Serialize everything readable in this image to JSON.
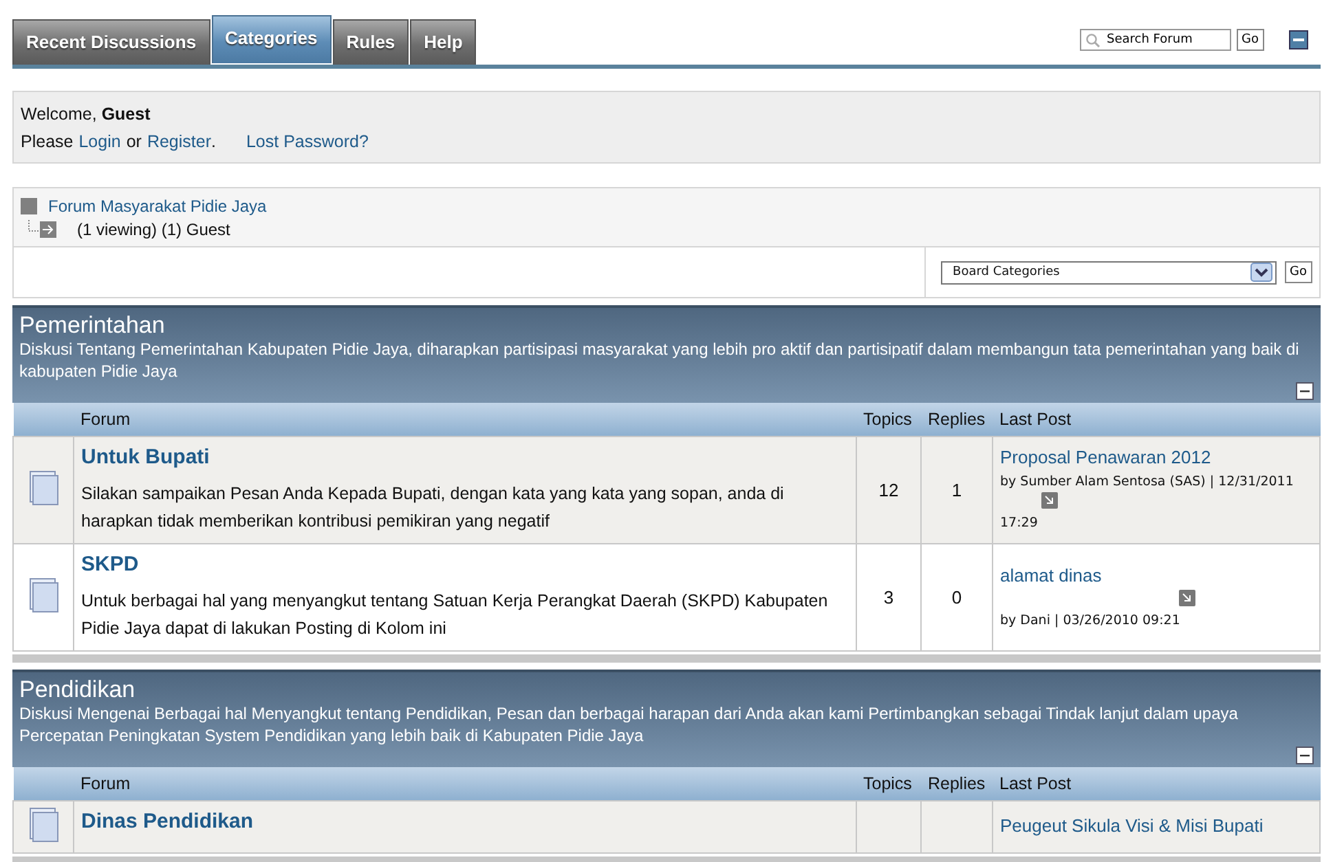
{
  "tabs": [
    {
      "label": "Recent Discussions",
      "selected": false
    },
    {
      "label": "Categories",
      "selected": true
    },
    {
      "label": "Rules",
      "selected": false
    },
    {
      "label": "Help",
      "selected": false
    }
  ],
  "search": {
    "placeholder": "Search Forum",
    "button": "Go"
  },
  "welcome": {
    "greeting": "Welcome, **Guest**",
    "prompt": "Please",
    "login": "Login",
    "connector": "or",
    "register": "Register",
    "period": ".",
    "lost_password": "Lost Password?"
  },
  "breadcrumb": {
    "forum": "Forum Masyarakat Pidie Jaya",
    "viewing": "(1 viewing) (1) Guest"
  },
  "jump": {
    "value": "Board Categories",
    "button": "Go"
  },
  "categories": [
    {
      "title": "Pemerintahan",
      "description": "Diskusi Tentang Pemerintahan Kabupaten Pidie Jaya, diharapkan partisipasi masyarakat yang lebih pro aktif dan partisipatif dalam membangun tata pemerintahan yang baik di kabupaten Pidie Jaya",
      "columns": [
        "Forum",
        "Topics",
        "Replies",
        "Last Post"
      ],
      "forums": [
        {
          "title": "Untuk Bupati",
          "description": "Silakan sampaikan Pesan Anda Kepada Bupati, dengan kata yang kata yang sopan, anda di harapkan tidak memberikan kontribusi pemikiran yang negatif",
          "topics": "12",
          "replies": "1",
          "last_post": {
            "title": "Proposal Penawaran 2012",
            "parts": [
              {
                "kind": "text",
                "text": "by Sumber Alam Sentosa (SAS) | 12/31/2011"
              },
              {
                "kind": "jump"
              },
              {
                "kind": "text",
                "text": "17:29"
              }
            ]
          }
        },
        {
          "title": "SKPD",
          "description": "Untuk berbagai hal yang menyangkut tentang Satuan Kerja Perangkat Daerah (SKPD) Kabupaten Pidie Jaya dapat di lakukan Posting di Kolom ini",
          "topics": "3",
          "replies": "0",
          "last_post": {
            "title": "alamat dinas",
            "parts": [
              {
                "kind": "jump"
              },
              {
                "kind": "text",
                "text": "by Dani | 03/26/2010 09:21"
              }
            ]
          }
        }
      ]
    },
    {
      "title": "Pendidikan",
      "description": "Diskusi Mengenai Berbagai hal Menyangkut tentang Pendidikan, Pesan dan berbagai harapan dari Anda akan kami Pertimbangkan sebagai Tindak lanjut dalam upaya Percepatan Peningkatan System Pendidikan yang lebih baik di Kabupaten Pidie Jaya",
      "columns": [
        "Forum",
        "Topics",
        "Replies",
        "Last Post"
      ],
      "forums": [
        {
          "title": "Dinas Pendidikan",
          "last_post": {
            "title": "Peugeut Sikula Visi & Misi Bupati"
          }
        }
      ]
    }
  ]
}
